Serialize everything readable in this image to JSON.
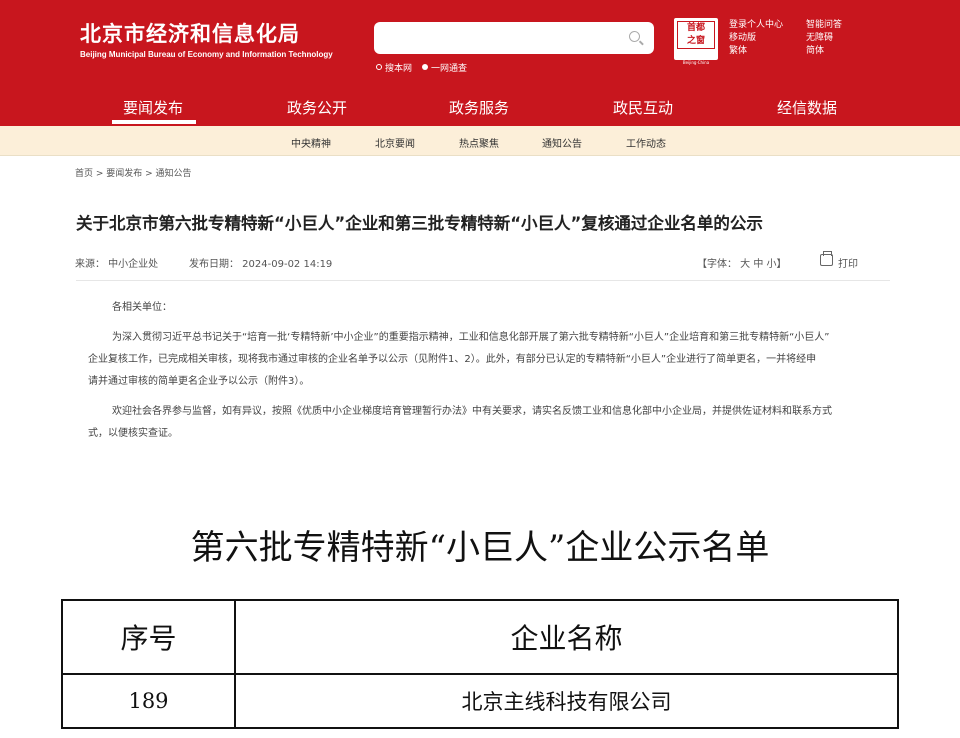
{
  "header": {
    "logo_cn": "北京市经济和信息化局",
    "logo_en": "Beijing Municipal Bureau of Economy and Information Technology",
    "search_option_site": "搜本网",
    "search_option_all": "一网通查",
    "seal_top": "首都",
    "seal_bottom": "之窗",
    "seal_sub": "Beijing·China",
    "links_col1": [
      "登录个人中心",
      "移动版",
      "繁体"
    ],
    "links_col2": [
      "智能问答",
      "无障碍",
      "简体"
    ]
  },
  "main_nav": [
    "要闻发布",
    "政务公开",
    "政务服务",
    "政民互动",
    "经信数据"
  ],
  "sub_nav": [
    "中央精神",
    "北京要闻",
    "热点聚焦",
    "通知公告",
    "工作动态"
  ],
  "breadcrumb": "首页 > 要闻发布 > 通知公告",
  "article": {
    "title": "关于北京市第六批专精特新“小巨人”企业和第三批专精特新“小巨人”复核通过企业名单的公示",
    "source": "来源：  中小企业处",
    "date": "发布日期：  2024-09-02 14:19",
    "font_size": "【字体：  大  中  小】",
    "print": "打印",
    "greeting": "各相关单位：",
    "para1_line1": "为深入贯彻习近平总书记关于“培育一批‘专精特新’中小企业”的重要指示精神，工业和信息化部开展了第六批专精特新“小巨人”企业培育和第三批专精特新“小巨人”",
    "para1_line2": "企业复核工作，已完成相关审核，现将我市通过审核的企业名单予以公示（见附件1、2）。此外，有部分已认定的专精特新“小巨人”企业进行了简单更名，一并将经申",
    "para1_line3": "请并通过审核的简单更名企业予以公示（附件3）。",
    "para2_line1": "欢迎社会各界参与监督，如有异议，按照《优质中小企业梯度培育管理暂行办法》中有关要求，请实名反馈工业和信息化部中小企业局，并提供佐证材料和联系方式",
    "para2_line2": "式，以便核实查证。"
  },
  "list": {
    "title": "第六批专精特新“小巨人”企业公示名单",
    "col_no": "序号",
    "col_name": "企业名称",
    "rows": [
      {
        "no": "189",
        "name": "北京主线科技有限公司"
      }
    ]
  }
}
